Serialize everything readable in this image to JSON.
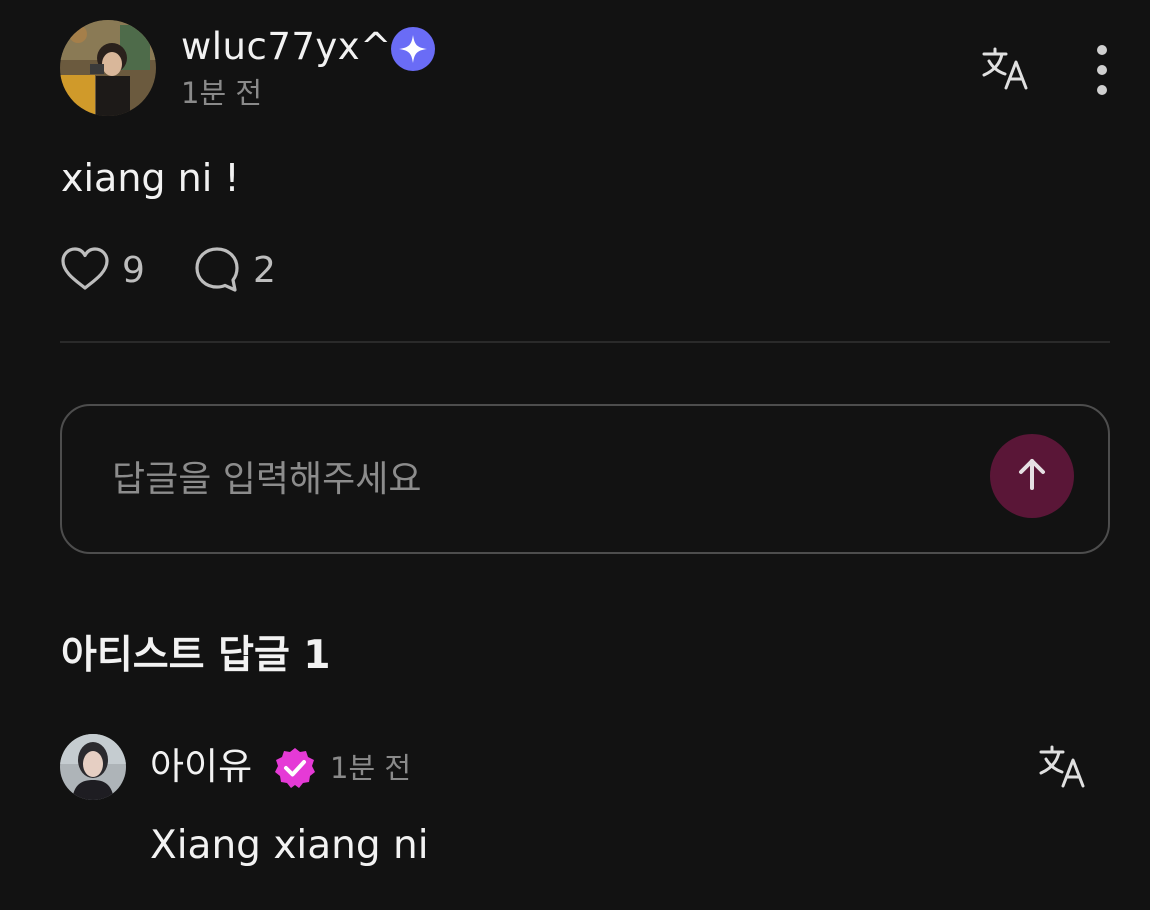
{
  "post": {
    "author": "wluc77yx^",
    "time": "1분 전",
    "text": "xiang ni !",
    "likes": "9",
    "comments": "2",
    "author_badge_icon": "sparkle-badge-icon",
    "badge_color": "#6a6cf6"
  },
  "reply_input": {
    "placeholder": "답글을 입력해주세요",
    "send_color": "#5a1637"
  },
  "artist_replies": {
    "title": "아티스트 답글 1",
    "items": [
      {
        "author": "아이유",
        "time": "1분 전",
        "text": "Xiang xiang ni",
        "badge_color": "#e53ad6"
      }
    ]
  }
}
